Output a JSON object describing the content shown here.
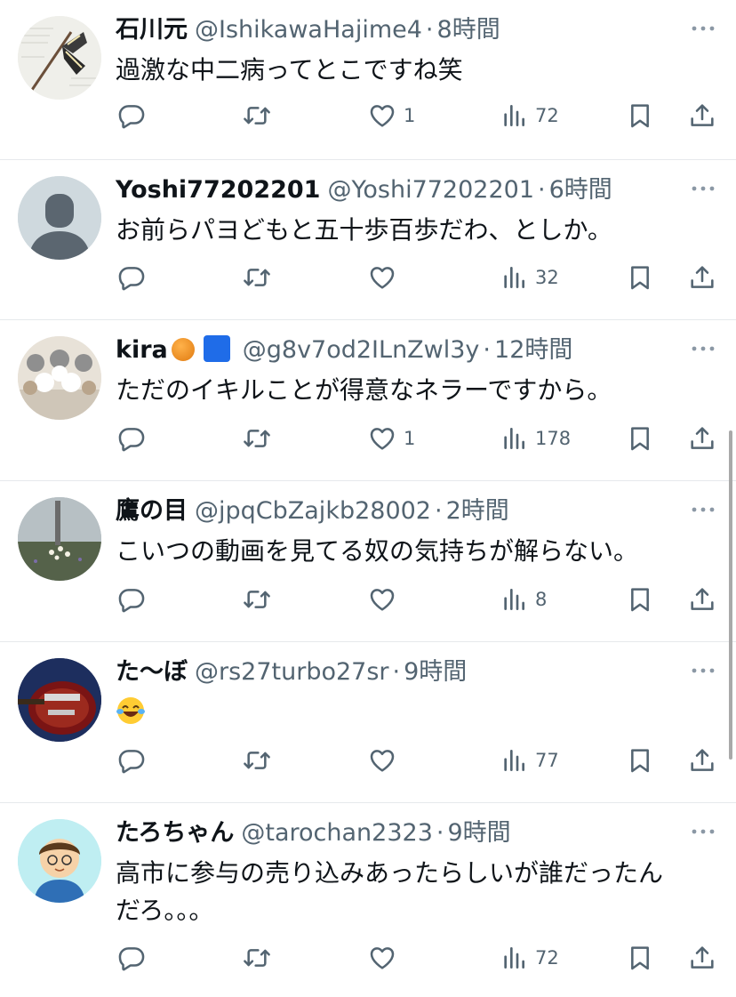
{
  "tweets": [
    {
      "name": "石川元",
      "handle": "@IshikawaHajime4",
      "separator": "·",
      "time": "8時間",
      "text": "過激な中二病ってとこですね笑",
      "text2": "",
      "likes": "1",
      "views": "72",
      "avatar": "butterfly-avatar"
    },
    {
      "name": "Yoshi77202201",
      "handle": "@Yoshi77202201",
      "separator": "·",
      "time": "6時間",
      "text": "お前らパヨどもと五十歩百歩だわ、としか。",
      "text2": "",
      "likes": "",
      "views": "32",
      "avatar": "default-avatar"
    },
    {
      "name": "kira",
      "handle": "@g8v7od2ILnZwl3y",
      "separator": "·",
      "time": "12時間",
      "text": "ただのイキルことが得意なネラーですから。",
      "text2": "",
      "likes": "1",
      "views": "178",
      "avatar": "cats-avatar"
    },
    {
      "name": "鷹の目",
      "handle": "@jpqCbZajkb28002",
      "separator": "·",
      "time": "2時間",
      "text": "こいつの動画を見てる奴の気持ちが解らない。",
      "text2": "",
      "likes": "",
      "views": "8",
      "avatar": "field-avatar"
    },
    {
      "name": "た〜ぼ",
      "handle": "@rs27turbo27sr",
      "separator": "·",
      "time": "9時間",
      "text": "",
      "text2": "",
      "likes": "",
      "views": "77",
      "avatar": "guitar-avatar"
    },
    {
      "name": "たろちゃん",
      "handle": "@tarochan2323",
      "separator": "·",
      "time": "9時間",
      "text": "高市に参与の売り込みあったらしいが誰だったん",
      "text2": "だろ。。。",
      "likes": "",
      "views": "72",
      "avatar": "cartoon-boy-avatar"
    }
  ],
  "colors": {
    "text": "#0f1419",
    "muted": "#536471",
    "divider": "#e6e9ec",
    "badge_blue": "#1f6ce8"
  },
  "icons": [
    "reply-icon",
    "retweet-icon",
    "like-icon",
    "views-icon",
    "bookmark-icon",
    "share-icon",
    "more-icon",
    "laughing-emoji-icon",
    "orange-emoji-icon",
    "blue-square-emoji-icon"
  ]
}
